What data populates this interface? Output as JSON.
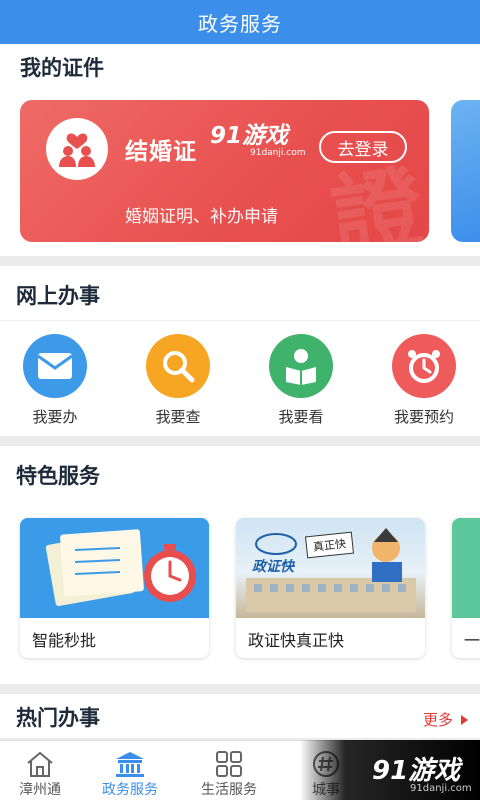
{
  "header": {
    "title": "政务服务"
  },
  "my_certs": {
    "title": "我的证件",
    "card": {
      "name": "结婚证",
      "login_label": "去登录",
      "subtitle": "婚姻证明、补办申请"
    },
    "watermark_brand": "91游戏",
    "watermark_url": "91danji.com"
  },
  "online": {
    "title": "网上办事",
    "items": [
      {
        "label": "我要办",
        "icon": "envelope-icon",
        "color": "#3c9ae8"
      },
      {
        "label": "我要查",
        "icon": "search-icon",
        "color": "#f6a623"
      },
      {
        "label": "我要看",
        "icon": "reader-icon",
        "color": "#3fb26b"
      },
      {
        "label": "我要预约",
        "icon": "alarm-clock-icon",
        "color": "#ef5b5b"
      }
    ]
  },
  "featured": {
    "title": "特色服务",
    "cards": [
      {
        "label": "智能秒批"
      },
      {
        "label": "政证快真正快",
        "banner_text": "政证快",
        "sign_text": "真正快"
      },
      {
        "label": "一"
      }
    ]
  },
  "hot": {
    "title": "热门办事",
    "more_label": "更多"
  },
  "tabbar": {
    "tabs": [
      {
        "label": "漳州通",
        "icon": "house-icon"
      },
      {
        "label": "政务服务",
        "icon": "government-icon",
        "active": true
      },
      {
        "label": "生活服务",
        "icon": "grid-icon"
      },
      {
        "label": "城事",
        "icon": "hash-icon"
      }
    ]
  },
  "corner_watermark": {
    "brand": "91游戏",
    "url": "91danji.com"
  }
}
